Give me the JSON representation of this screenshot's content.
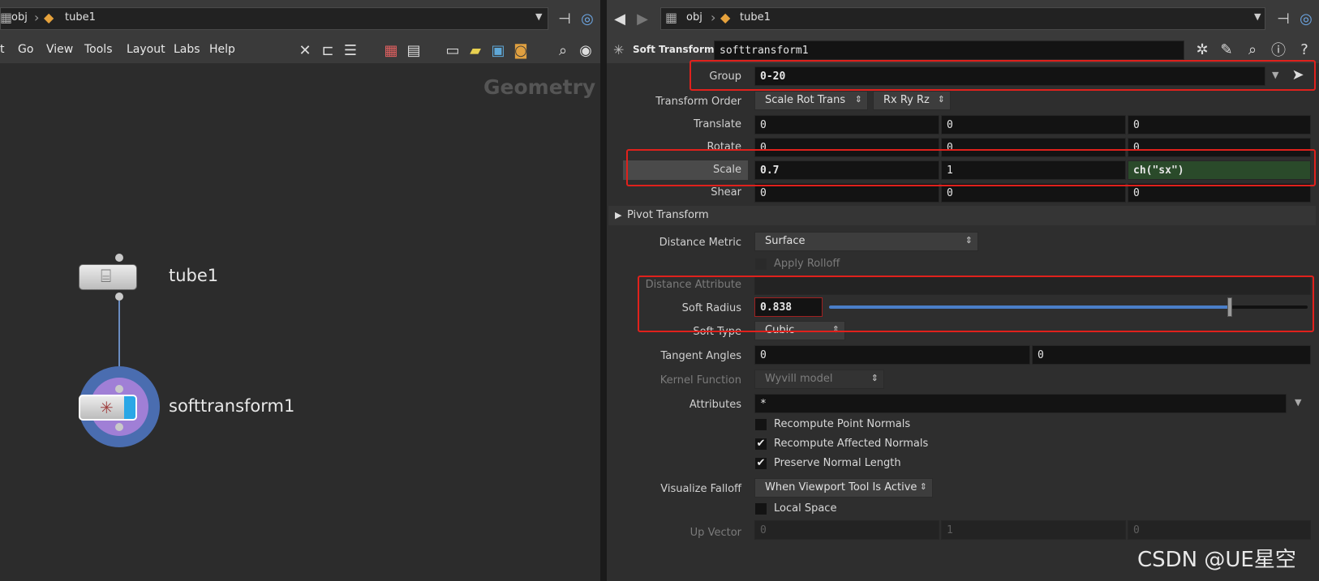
{
  "left_pane": {
    "path": {
      "root": "obj",
      "current": "tube1"
    },
    "menu": [
      "t",
      "Go",
      "View",
      "Tools",
      "Layout",
      "Labs",
      "Help"
    ],
    "context_label": "Geometry",
    "nodes": [
      {
        "name": "tube1",
        "icon": "tube-icon"
      },
      {
        "name": "softtransform1",
        "icon": "softtransform-icon"
      }
    ]
  },
  "right_pane": {
    "path": {
      "root": "obj",
      "current": "tube1"
    },
    "node_type": "Soft Transform",
    "node_name": "softtransform1",
    "params": {
      "group": {
        "label": "Group",
        "value": "0-20"
      },
      "transform_order": {
        "label": "Transform Order",
        "value1": "Scale Rot Trans",
        "value2": "Rx Ry Rz"
      },
      "translate": {
        "label": "Translate",
        "values": [
          "0",
          "0",
          "0"
        ]
      },
      "rotate": {
        "label": "Rotate",
        "values": [
          "0",
          "0",
          "0"
        ]
      },
      "scale": {
        "label": "Scale",
        "values": [
          "0.7",
          "1",
          "ch(\"sx\")"
        ]
      },
      "shear": {
        "label": "Shear",
        "values": [
          "0",
          "0",
          "0"
        ]
      },
      "pivot_transform": {
        "label": "Pivot Transform"
      },
      "distance_metric": {
        "label": "Distance Metric",
        "value": "Surface"
      },
      "apply_rolloff": {
        "label": "Apply Rolloff"
      },
      "distance_attribute": {
        "label": "Distance Attribute"
      },
      "soft_radius": {
        "label": "Soft Radius",
        "value": "0.838",
        "slider_fraction": 0.838
      },
      "soft_type": {
        "label": "Soft Type",
        "value": "Cubic"
      },
      "tangent_angles": {
        "label": "Tangent Angles",
        "values": [
          "0",
          "0"
        ]
      },
      "kernel_function": {
        "label": "Kernel Function",
        "value": "Wyvill model"
      },
      "attributes": {
        "label": "Attributes",
        "value": "*"
      },
      "recompute_point_normals": {
        "label": "Recompute Point Normals",
        "checked": false
      },
      "recompute_affected_normals": {
        "label": "Recompute Affected Normals",
        "checked": true
      },
      "preserve_normal_length": {
        "label": "Preserve Normal Length",
        "checked": true
      },
      "visualize_falloff": {
        "label": "Visualize Falloff",
        "value": "When Viewport Tool Is Active"
      },
      "local_space": {
        "label": "Local Space",
        "checked": false
      },
      "up_vector": {
        "label": "Up Vector",
        "values": [
          "0",
          "1",
          "0"
        ]
      }
    }
  },
  "watermark": "CSDN @UE星空",
  "colors": {
    "highlight": "#e0211c",
    "expression_bg": "#2a4a2a",
    "node_selected": "#7a9ccf"
  }
}
